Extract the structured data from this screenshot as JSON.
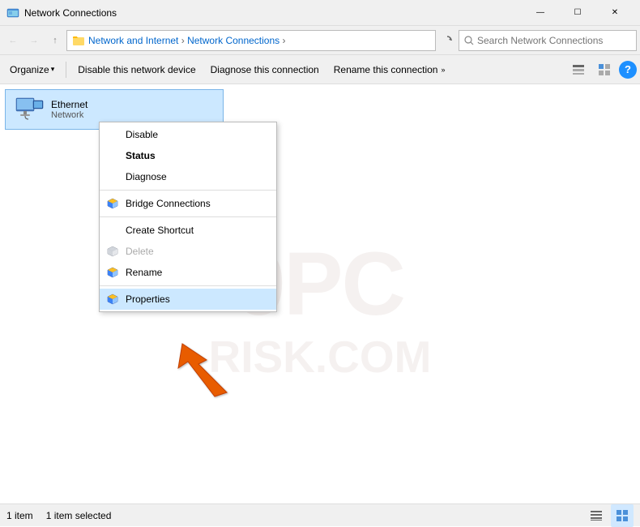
{
  "window": {
    "title": "Network Connections",
    "icon": "network-connections-icon"
  },
  "titlebar": {
    "title": "Network Connections",
    "minimize_label": "—",
    "maximize_label": "☐",
    "close_label": "✕"
  },
  "addressbar": {
    "back_tooltip": "Back",
    "forward_tooltip": "Forward",
    "up_tooltip": "Up",
    "path": [
      "Network and Internet",
      "Network Connections"
    ],
    "search_placeholder": "Search Network Connections",
    "refresh_tooltip": "Refresh"
  },
  "toolbar": {
    "organize_label": "Organize",
    "organize_arrow": "▾",
    "disable_label": "Disable this network device",
    "diagnose_label": "Diagnose this connection",
    "rename_label": "Rename this connection",
    "rename_arrow": "»"
  },
  "file_item": {
    "name": "Ethernet",
    "desc": "Network"
  },
  "context_menu": {
    "items": [
      {
        "id": "disable",
        "label": "Disable",
        "icon": null,
        "bold": false,
        "disabled": false
      },
      {
        "id": "status",
        "label": "Status",
        "icon": null,
        "bold": true,
        "disabled": false
      },
      {
        "id": "diagnose",
        "label": "Diagnose",
        "icon": null,
        "bold": false,
        "disabled": false
      },
      {
        "id": "sep1",
        "type": "separator"
      },
      {
        "id": "bridge",
        "label": "Bridge Connections",
        "icon": "shield",
        "bold": false,
        "disabled": false
      },
      {
        "id": "sep2",
        "type": "separator"
      },
      {
        "id": "shortcut",
        "label": "Create Shortcut",
        "icon": null,
        "bold": false,
        "disabled": false
      },
      {
        "id": "delete",
        "label": "Delete",
        "icon": "shield",
        "bold": false,
        "disabled": true
      },
      {
        "id": "rename",
        "label": "Rename",
        "icon": "shield",
        "bold": false,
        "disabled": false
      },
      {
        "id": "sep3",
        "type": "separator"
      },
      {
        "id": "properties",
        "label": "Properties",
        "icon": "shield",
        "bold": false,
        "disabled": false,
        "highlighted": true
      }
    ]
  },
  "statusbar": {
    "count": "1 item",
    "selected": "1 item selected"
  },
  "watermark": {
    "line1": "9PC",
    "line2": "RISK.COM"
  }
}
